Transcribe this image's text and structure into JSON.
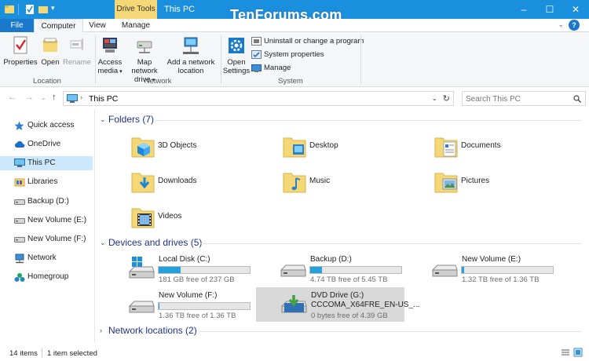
{
  "window": {
    "context_tab_label": "Drive Tools",
    "title": "This PC",
    "watermark": "TenForums.com",
    "colors": {
      "titlebar": "#1a8fdd",
      "drive_tools": "#f4d877",
      "accent": "#1979ca",
      "selection": "#cce8ff",
      "bar_fill": "#26a0da"
    }
  },
  "tabs": {
    "file": "File",
    "computer": "Computer",
    "view": "View",
    "manage": "Manage"
  },
  "ribbon": {
    "location": {
      "label": "Location",
      "properties": "Properties",
      "open": "Open",
      "rename": "Rename"
    },
    "network": {
      "label": "Network",
      "access_media": "Access media",
      "map_drive": "Map network drive",
      "add_location": "Add a network location"
    },
    "system": {
      "label": "System",
      "open_settings": "Open Settings",
      "uninstall": "Uninstall or change a program",
      "sysprops": "System properties",
      "manage": "Manage"
    }
  },
  "address": {
    "path": "This PC",
    "search_placeholder": "Search This PC"
  },
  "nav": [
    {
      "label": "Quick access",
      "icon": "star-icon"
    },
    {
      "label": "OneDrive",
      "icon": "cloud-icon"
    },
    {
      "label": "This PC",
      "icon": "monitor-icon",
      "selected": true
    },
    {
      "label": "Libraries",
      "icon": "libraries-icon"
    },
    {
      "label": "Backup (D:)",
      "icon": "drive-icon"
    },
    {
      "label": "New Volume (E:)",
      "icon": "drive-icon"
    },
    {
      "label": "New Volume (F:)",
      "icon": "drive-icon"
    },
    {
      "label": "Network",
      "icon": "network-icon"
    },
    {
      "label": "Homegroup",
      "icon": "homegroup-icon"
    }
  ],
  "sections": {
    "folders": "Folders (7)",
    "devices": "Devices and drives (5)",
    "network": "Network locations (2)"
  },
  "folders": [
    "3D Objects",
    "Desktop",
    "Documents",
    "Downloads",
    "Music",
    "Pictures",
    "Videos"
  ],
  "drives": [
    {
      "name": "Local Disk (C:)",
      "free_text": "181 GB free of 237 GB",
      "used_fraction": 0.24
    },
    {
      "name": "Backup (D:)",
      "free_text": "4.74 TB free of 5.45 TB",
      "used_fraction": 0.13
    },
    {
      "name": "New Volume (E:)",
      "free_text": "1.32 TB free of 1.36 TB",
      "used_fraction": 0.03
    },
    {
      "name": "New Volume (F:)",
      "free_text": "1.36 TB free of 1.36 TB",
      "used_fraction": 0.005
    },
    {
      "name": "DVD Drive (G:)",
      "label2": "CCCOMA_X64FRE_EN-US_...",
      "free_text": "0 bytes free of 4.39 GB",
      "selected": true
    }
  ],
  "status": {
    "items": "14 items",
    "selected": "1 item selected"
  }
}
